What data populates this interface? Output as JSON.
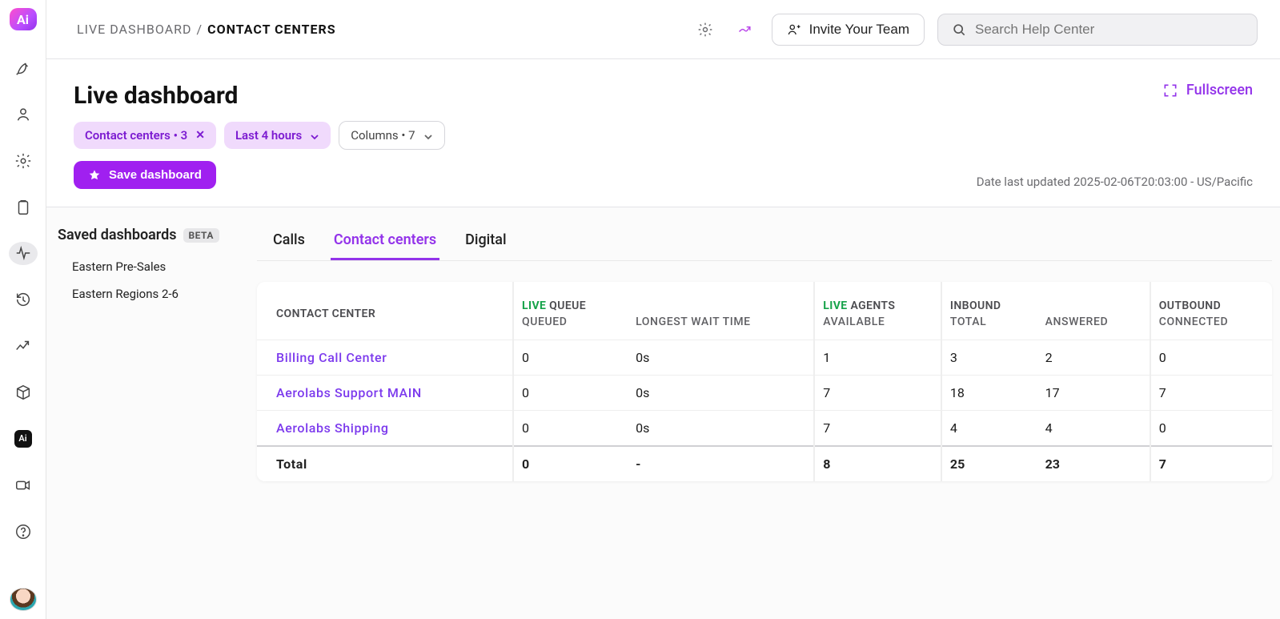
{
  "breadcrumb": {
    "parent": "LIVE DASHBOARD",
    "sep": " / ",
    "current": "CONTACT CENTERS"
  },
  "topbar": {
    "invite_label": "Invite Your Team",
    "search_placeholder": "Search Help Center"
  },
  "header": {
    "title": "Live dashboard",
    "filter_centers": "Contact centers • 3",
    "filter_time": "Last 4 hours",
    "columns_chip": "Columns • 7",
    "save_label": "Save dashboard",
    "fullscreen_label": "Fullscreen",
    "updated_prefix": "Date last updated ",
    "updated_value": "2025-02-06T20:03:00 - US/Pacific"
  },
  "sidepanel": {
    "title": "Saved dashboards",
    "beta": "BETA",
    "items": [
      {
        "label": "Eastern Pre-Sales"
      },
      {
        "label": "Eastern Regions 2-6"
      }
    ]
  },
  "tabs": {
    "calls": "Calls",
    "contact_centers": "Contact centers",
    "digital": "Digital"
  },
  "table": {
    "headers": {
      "contact_center": "CONTACT CENTER",
      "live": "LIVE",
      "queue": " QUEUE",
      "queued": "QUEUED",
      "longest_wait": "LONGEST WAIT TIME",
      "agents": " AGENTS",
      "available": "AVAILABLE",
      "inbound": "INBOUND",
      "total": "TOTAL",
      "answered": "ANSWERED",
      "outbound": "OUTBOUND",
      "connected": "CONNECTED"
    },
    "rows": [
      {
        "name": "Billing Call Center",
        "queued": "0",
        "longest": "0s",
        "available": "1",
        "inbound_total": "3",
        "answered": "2",
        "out_connected": "0"
      },
      {
        "name": "Aerolabs Support MAIN",
        "queued": "0",
        "longest": "0s",
        "available": "7",
        "inbound_total": "18",
        "answered": "17",
        "out_connected": "7"
      },
      {
        "name": "Aerolabs Shipping",
        "queued": "0",
        "longest": "0s",
        "available": "7",
        "inbound_total": "4",
        "answered": "4",
        "out_connected": "0"
      }
    ],
    "total": {
      "label": "Total",
      "queued": "0",
      "longest": "-",
      "available": "8",
      "inbound_total": "25",
      "answered": "23",
      "out_connected": "7"
    }
  }
}
